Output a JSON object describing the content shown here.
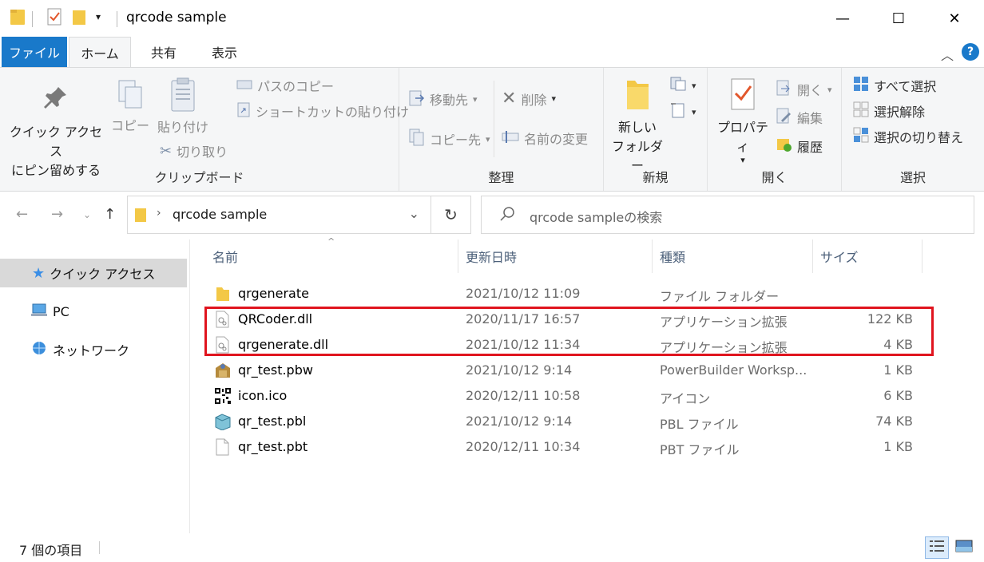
{
  "window": {
    "title": "qrcode sample",
    "minimize": "—",
    "maximize": "☐",
    "close": "✕"
  },
  "ribbon_tabs": [
    "ファイル",
    "ホーム",
    "共有",
    "表示"
  ],
  "ribbon": {
    "clipboard": {
      "label": "クリップボード",
      "pin_line1": "クイック アクセス",
      "pin_line2": "にピン留めする",
      "copy": "コピー",
      "paste": "貼り付け",
      "copy_path": "パスのコピー",
      "paste_shortcut": "ショートカットの貼り付け",
      "cut": "切り取り"
    },
    "organize": {
      "label": "整理",
      "move_to": "移動先",
      "copy_to": "コピー先",
      "delete": "削除",
      "rename": "名前の変更"
    },
    "new": {
      "label": "新規",
      "new_folder_line1": "新しい",
      "new_folder_line2": "フォルダー"
    },
    "open": {
      "label": "開く",
      "properties": "プロパティ",
      "open": "開く",
      "edit": "編集",
      "history": "履歴"
    },
    "select": {
      "label": "選択",
      "select_all": "すべて選択",
      "select_none": "選択解除",
      "invert": "選択の切り替え"
    }
  },
  "address": {
    "path": "qrcode sample",
    "search_placeholder": "qrcode sampleの検索"
  },
  "nav_pane": {
    "items": [
      "クイック アクセス",
      "PC",
      "ネットワーク"
    ]
  },
  "columns": [
    "名前",
    "更新日時",
    "種類",
    "サイズ"
  ],
  "files": [
    {
      "name": "qrgenerate",
      "date": "2021/10/12 11:09",
      "type": "ファイル フォルダー",
      "size": "",
      "icon": "folder-icon"
    },
    {
      "name": "QRCoder.dll",
      "date": "2020/11/17 16:57",
      "type": "アプリケーション拡張",
      "size": "122 KB",
      "icon": "dll-icon"
    },
    {
      "name": "qrgenerate.dll",
      "date": "2021/10/12 11:34",
      "type": "アプリケーション拡張",
      "size": "4 KB",
      "icon": "dll-icon"
    },
    {
      "name": "qr_test.pbw",
      "date": "2021/10/12 9:14",
      "type": "PowerBuilder Worksp...",
      "size": "1 KB",
      "icon": "pbw-icon"
    },
    {
      "name": "icon.ico",
      "date": "2020/12/11 10:58",
      "type": "アイコン",
      "size": "6 KB",
      "icon": "qr-ico-icon"
    },
    {
      "name": "qr_test.pbl",
      "date": "2021/10/12 9:14",
      "type": "PBL ファイル",
      "size": "74 KB",
      "icon": "pbl-icon"
    },
    {
      "name": "qr_test.pbt",
      "date": "2020/12/11 10:34",
      "type": "PBT ファイル",
      "size": "1 KB",
      "icon": "blank-file-icon"
    }
  ],
  "status": {
    "count": "7 個の項目"
  },
  "colors": {
    "accent": "#1979ca",
    "highlight_box": "#e0141e",
    "ribbon_bg": "#f5f6f7"
  }
}
